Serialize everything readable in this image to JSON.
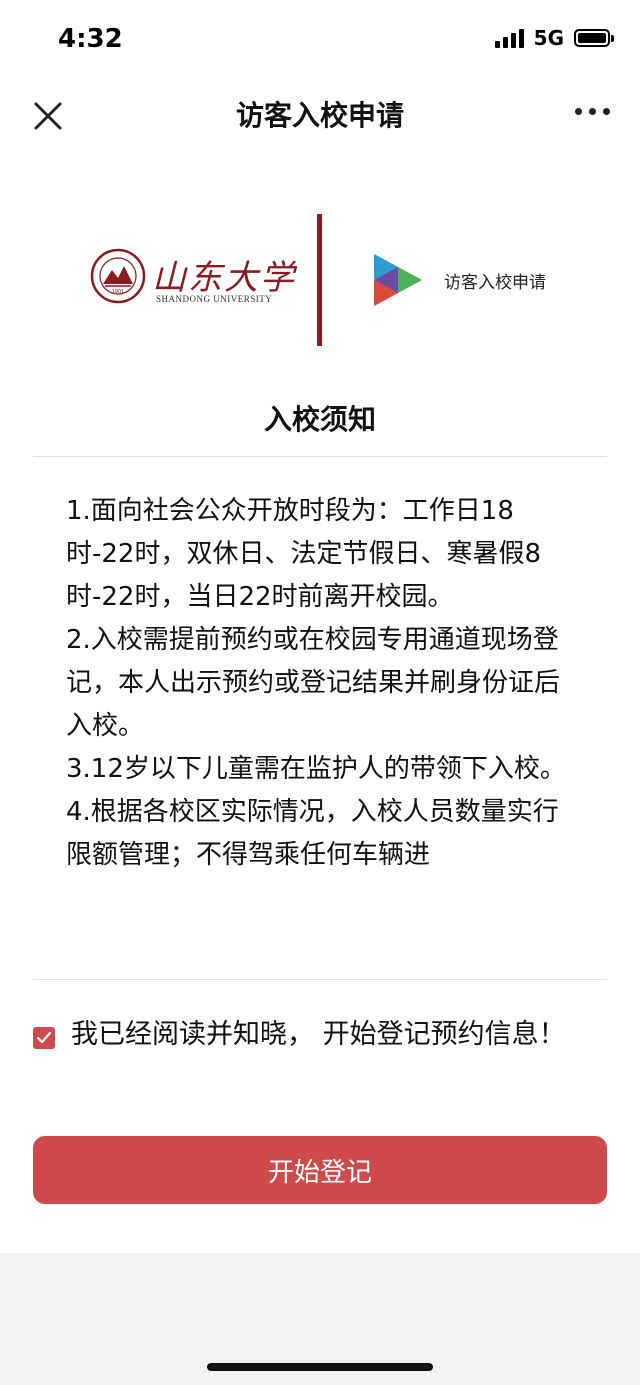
{
  "status_bar": {
    "time": "4:32",
    "network": "5G"
  },
  "nav": {
    "title": "访客入校申请"
  },
  "logo": {
    "university_cn": "山东大学",
    "university_en": "SHANDONG UNIVERSITY",
    "seal_year": "1901",
    "app_label": "访客入校申请",
    "brand_color": "#8a1c20"
  },
  "notice": {
    "title": "入校须知",
    "body": "1.面向社会公众开放时段为：工作日18时-22时，双休日、法定节假日、寒暑假8时-22时，当日22时前离开校园。\n2.入校需提前预约或在校园专用通道现场登记，本人出示预约或登记结果并刷身份证后入校。\n3.12岁以下儿童需在监护人的带领下入校。\n4.根据各校区实际情况，入校人员数量实行限额管理；不得驾乘任何车辆进"
  },
  "agreement": {
    "checked": true,
    "text": "我已经阅读并知晓， 开始登记预约信息！"
  },
  "actions": {
    "start_label": "开始登记",
    "accent_color": "#cf4b4b"
  }
}
